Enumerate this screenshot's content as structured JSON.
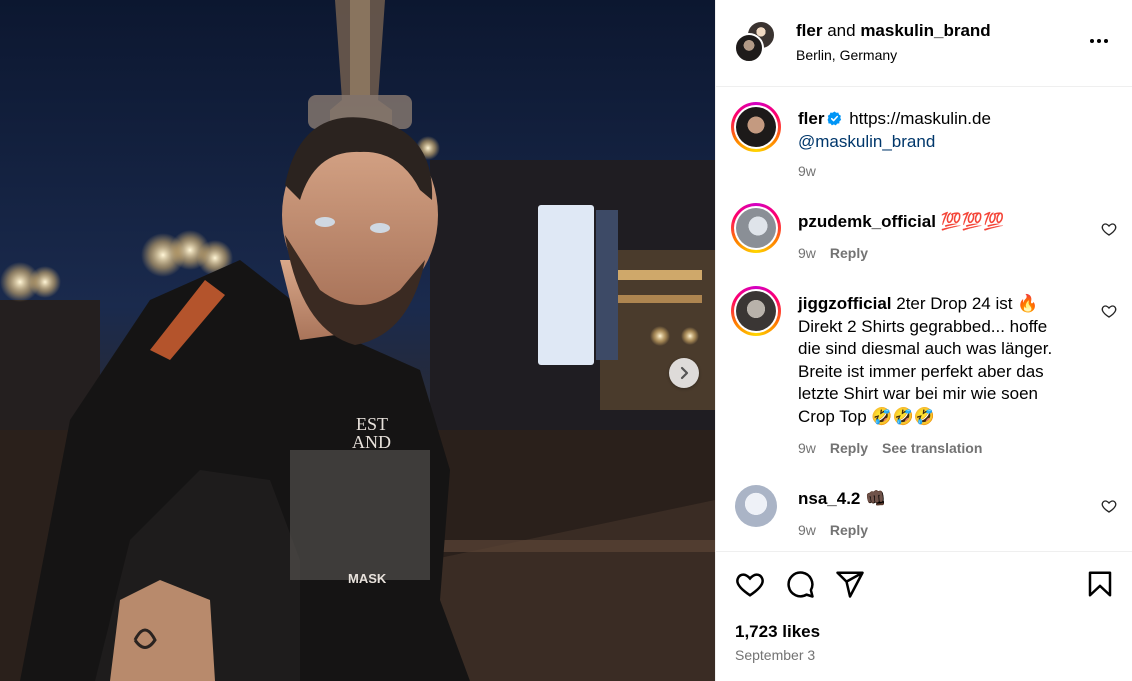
{
  "post": {
    "header": {
      "user1": "fler",
      "and_text": "and",
      "user2": "maskulin_brand",
      "location": "Berlin, Germany"
    },
    "caption": {
      "username": "fler",
      "link": "https://maskulin.de",
      "mention": "@maskulin_brand",
      "time": "9w"
    },
    "comments": [
      {
        "username": "pzudemk_official",
        "text": "💯💯💯",
        "time": "9w",
        "reply": "Reply"
      },
      {
        "username": "jiggzofficial",
        "text_lines": [
          "2ter Drop 24 ist 🔥",
          "Direkt 2 Shirts gegrabbed... hoffe",
          "die sind diesmal auch was länger.",
          "Breite ist immer perfekt aber das",
          "letzte Shirt war bei mir wie soen",
          "Crop Top 🤣🤣🤣"
        ],
        "time": "9w",
        "reply": "Reply",
        "translate": "See translation"
      },
      {
        "username": "nsa_4.2",
        "text": "👊🏿",
        "time": "9w",
        "reply": "Reply"
      }
    ],
    "likes": "1,723 likes",
    "date": "September 3",
    "icons": [
      "more-icon",
      "verified-icon",
      "like-icon",
      "comment-icon",
      "share-icon",
      "save-icon",
      "chevron-right-icon"
    ]
  }
}
